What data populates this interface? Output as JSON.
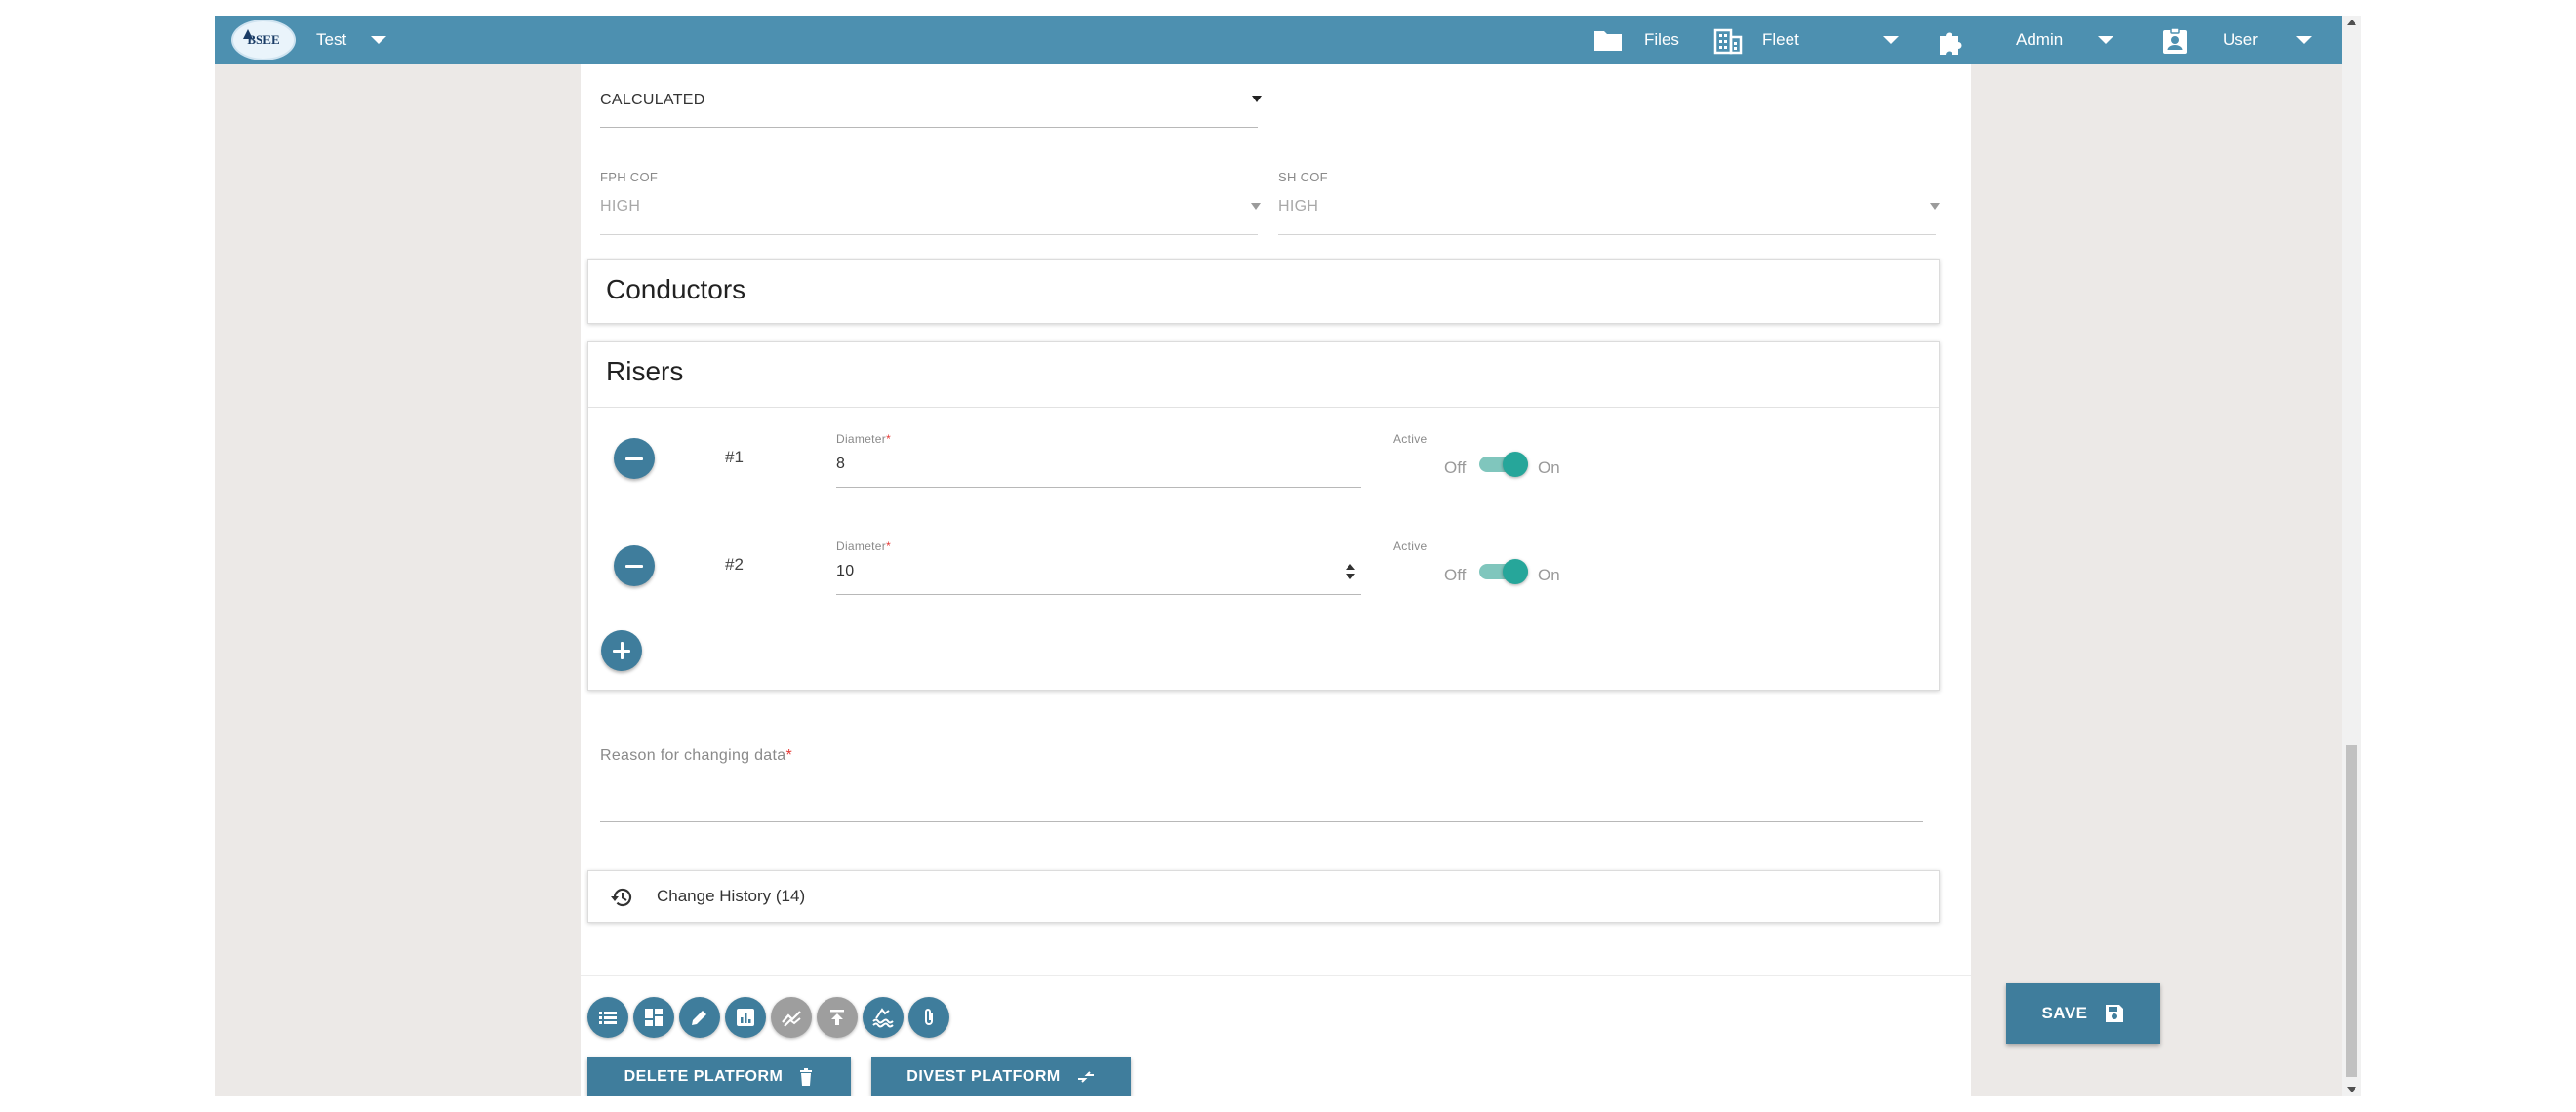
{
  "topbar": {
    "logo_text": "BSEE",
    "workspace_label": "Test",
    "files_label": "Files",
    "fleet_label": "Fleet",
    "admin_label": "Admin",
    "user_label": "User"
  },
  "form": {
    "calculation_select": {
      "value": "CALCULATED"
    },
    "fph_cof": {
      "label": "FPH COF",
      "value": "HIGH"
    },
    "sh_cof": {
      "label": "SH COF",
      "value": "HIGH"
    }
  },
  "conductors": {
    "title": "Conductors"
  },
  "risers": {
    "title": "Risers",
    "diameter_label": "Diameter",
    "required_mark": "*",
    "active_label": "Active",
    "off_label": "Off",
    "on_label": "On",
    "items": [
      {
        "number": "#1",
        "diameter": "8",
        "active": true
      },
      {
        "number": "#2",
        "diameter": "10",
        "active": true
      }
    ]
  },
  "reason": {
    "label": "Reason for changing data",
    "required_mark": "*",
    "value": ""
  },
  "change_history": {
    "label": "Change History (14)"
  },
  "actions": {
    "icons": [
      "list-icon",
      "dashboard-icon",
      "edit-icon",
      "report-chart-icon",
      "trend-icon",
      "upload-icon",
      "water-icon",
      "attachment-icon"
    ],
    "save_label": "SAVE",
    "delete_label": "DELETE PLATFORM",
    "divest_label": "DIVEST PLATFORM"
  },
  "colors": {
    "topbar": "#4d90b0",
    "primary_button": "#3f7d9c",
    "toggle_active": "#26a69a",
    "page_background": "#ece9e7"
  }
}
